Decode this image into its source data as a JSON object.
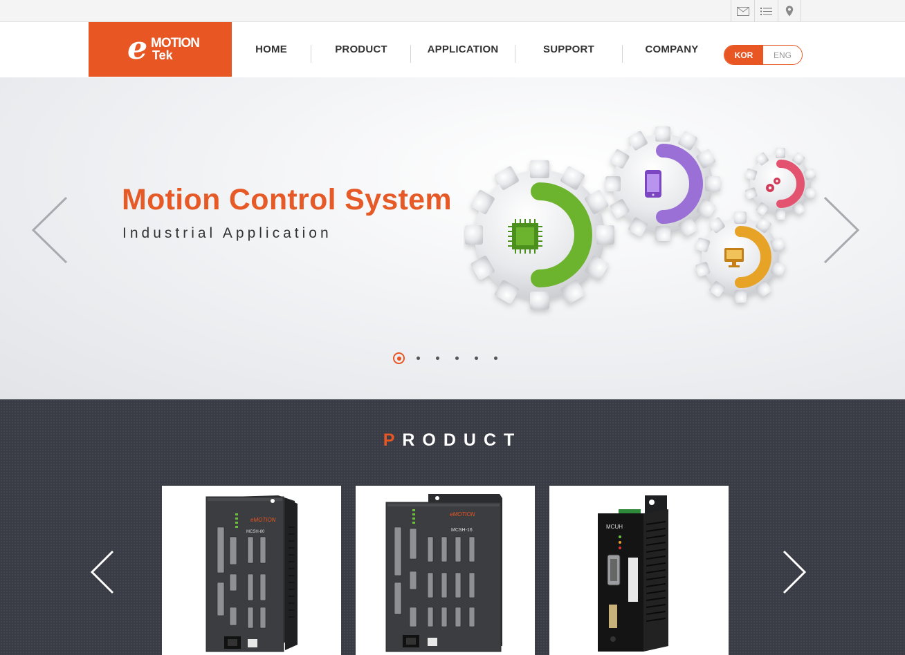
{
  "topbar": {
    "icons": [
      "mail-icon",
      "list-icon",
      "location-pin-icon"
    ]
  },
  "logo": {
    "e": "e",
    "motion": "MOTION",
    "tek": "Tek",
    "color": "#e75623"
  },
  "nav": {
    "items": [
      {
        "label": "HOME"
      },
      {
        "label": "PRODUCT"
      },
      {
        "label": "APPLICATION"
      },
      {
        "label": "SUPPORT"
      },
      {
        "label": "COMPANY"
      }
    ]
  },
  "lang": {
    "kor": "KOR",
    "eng": "ENG",
    "active": "KOR"
  },
  "hero": {
    "title": "Motion Control System",
    "subtitle": "Industrial Application",
    "slide_count": 6,
    "active_slide": 1,
    "gear_icons": [
      "chip-icon",
      "phone-icon",
      "monitor-icon",
      "gears-icon"
    ],
    "accent_colors": {
      "green": "#6cb32f",
      "purple": "#9a6fd6",
      "orange": "#e7a326",
      "pink": "#e35370"
    }
  },
  "product": {
    "heading_first": "P",
    "heading_rest": "RODUCT",
    "cards": [
      {
        "model": "MCSH-80"
      },
      {
        "model": "MCSH-16"
      },
      {
        "model": "MCUH"
      }
    ]
  },
  "colors": {
    "accent": "#e75623",
    "product_bg": "#3a3c45"
  }
}
